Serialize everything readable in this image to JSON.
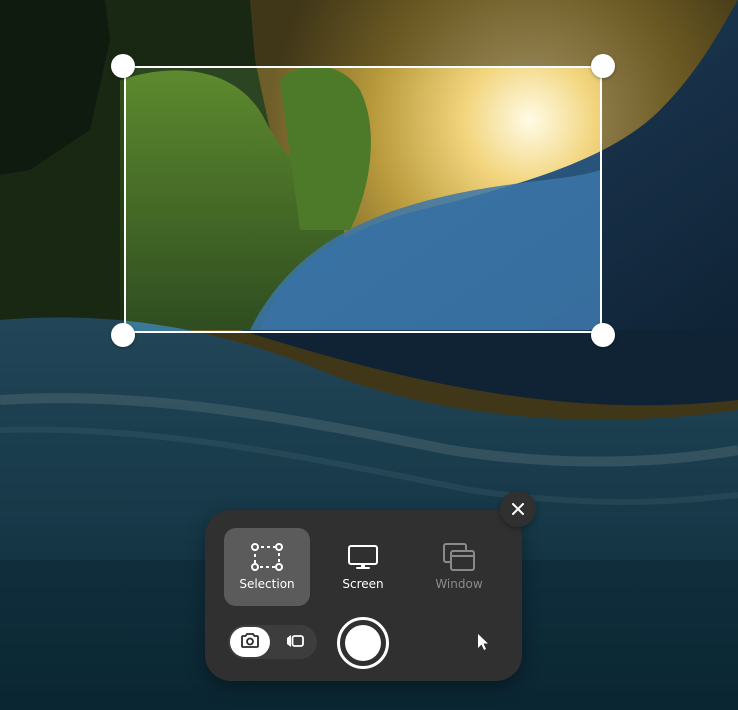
{
  "screenshot_ui": {
    "close_icon": "close-icon",
    "modes": [
      {
        "label": "Selection",
        "icon": "selection-icon",
        "state": "active"
      },
      {
        "label": "Screen",
        "icon": "monitor-icon",
        "state": "normal"
      },
      {
        "label": "Window",
        "icon": "window-icon",
        "state": "disabled"
      }
    ],
    "capture_types": [
      {
        "icon": "camera-icon",
        "state": "active"
      },
      {
        "icon": "video-camera-icon",
        "state": "normal"
      }
    ],
    "capture_button_icon": "shutter-button",
    "pointer_toggle_icon": "mouse-pointer-icon"
  },
  "colors": {
    "panel_bg": "#303030",
    "active_mode_bg": "#5b5b5b",
    "toggle_bg": "#3d3d3d",
    "accent": "#ffffff"
  }
}
